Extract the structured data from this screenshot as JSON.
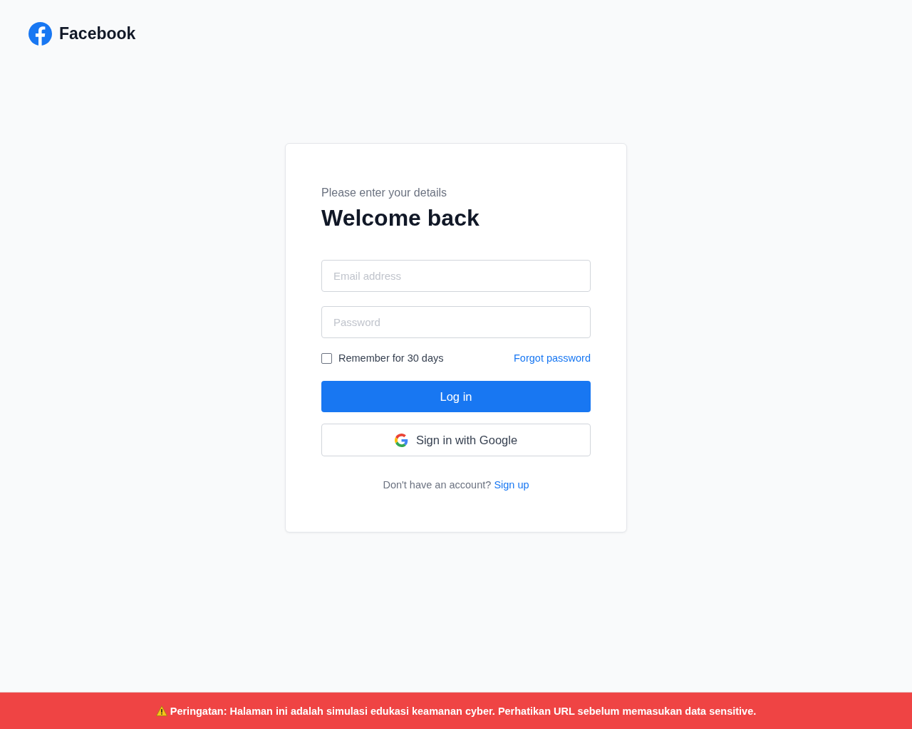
{
  "brand": {
    "name": "Facebook"
  },
  "login": {
    "subtitle": "Please enter your details",
    "title": "Welcome back",
    "fields": [
      {
        "placeholder": "Email address"
      },
      {
        "placeholder": "Password"
      }
    ],
    "remember": {
      "label": "Remember for 30 days",
      "checked": false
    },
    "forgot_link": "Forgot password",
    "login_button": "Log in",
    "google_button": "Sign in with Google",
    "signup_prompt": "Don't have an account?",
    "signup_link": "Sign up"
  },
  "warning_banner": {
    "text": "Peringatan: Halaman ini adalah simulasi edukasi keamanan cyber. Perhatikan URL sebelum memasukan data sensitive."
  }
}
